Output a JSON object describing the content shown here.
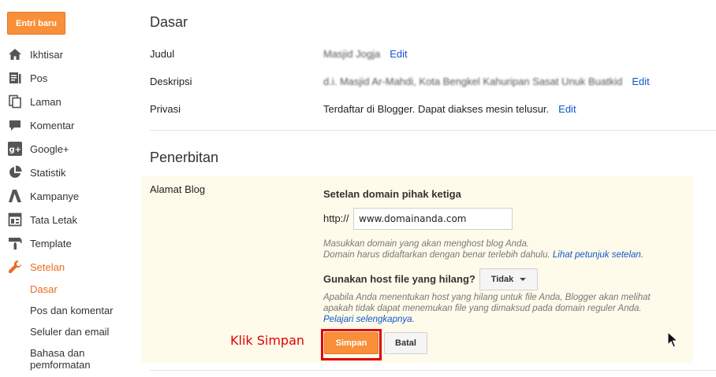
{
  "sidebar": {
    "new_post_label": "Entri baru",
    "items": [
      {
        "label": "Ikhtisar",
        "icon": "home-icon"
      },
      {
        "label": "Pos",
        "icon": "posts-icon"
      },
      {
        "label": "Laman",
        "icon": "pages-icon"
      },
      {
        "label": "Komentar",
        "icon": "comment-icon"
      },
      {
        "label": "Google+",
        "icon": "google-plus-icon"
      },
      {
        "label": "Statistik",
        "icon": "stats-icon"
      },
      {
        "label": "Kampanye",
        "icon": "campaign-icon"
      },
      {
        "label": "Tata Letak",
        "icon": "layout-icon"
      },
      {
        "label": "Template",
        "icon": "template-icon"
      },
      {
        "label": "Setelan",
        "icon": "wrench-icon",
        "active": true
      }
    ],
    "sub_items": [
      {
        "label": "Dasar",
        "active": true
      },
      {
        "label": "Pos dan komentar"
      },
      {
        "label": "Seluler dan email"
      },
      {
        "label": "Bahasa dan pemformatan"
      }
    ],
    "accent_color": "#e96c20"
  },
  "basic": {
    "title": "Dasar",
    "rows": [
      {
        "label": "Judul",
        "value": "Masjid Jogja",
        "edit": "Edit"
      },
      {
        "label": "Deskripsi",
        "value": "d.i. Masjid Ar-Mahdi, Kota Bengkel Kahuripan Sasat Unuk Buatkid",
        "edit": "Edit"
      },
      {
        "label": "Privasi",
        "value": "Terdaftar di Blogger. Dapat diakses mesin telusur.",
        "edit": "Edit"
      }
    ]
  },
  "publishing": {
    "title": "Penerbitan",
    "blog_address_label": "Alamat Blog",
    "third_party_title": "Setelan domain pihak ketiga",
    "http_prefix": "http://",
    "domain_value": "www.domainanda.com",
    "hint_line1": "Masukkan domain yang akan menghost blog Anda.",
    "hint_line2": "Domain harus didaftarkan dengan benar terlebih dahulu.",
    "hint_link": "Lihat petunjuk setelan.",
    "missing_host_question": "Gunakan host file yang hilang?",
    "missing_host_value": "Tidak",
    "explain_line1": "Apabila Anda menentukan host yang hilang untuk file Anda, Blogger akan melihat",
    "explain_line2": "apakah tidak dapat menemukan file yang dimaksud pada domain reguler Anda.",
    "learn_more": "Pelajari selengkapnya.",
    "save_label": "Simpan",
    "cancel_label": "Batal"
  },
  "annotation": {
    "text": "Klik Simpan",
    "color": "#e00000"
  }
}
